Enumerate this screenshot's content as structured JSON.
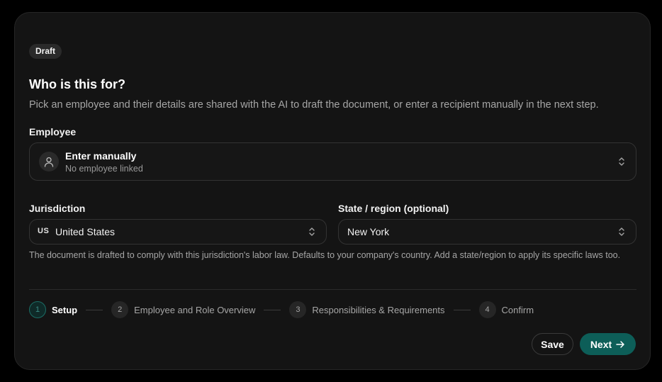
{
  "badge": "Draft",
  "title": "Who is this for?",
  "subtitle": "Pick an employee and their details are shared with the AI to draft the document, or enter a recipient manually in the next step.",
  "employee": {
    "label": "Employee",
    "value": "Enter manually",
    "subtext": "No employee linked"
  },
  "jurisdiction": {
    "label": "Jurisdiction",
    "flag": "US",
    "value": "United States"
  },
  "state": {
    "label": "State / region (optional)",
    "value": "New York"
  },
  "help_text": "The document is drafted to comply with this jurisdiction's labor law. Defaults to your company's country. Add a state/region to apply its specific laws too.",
  "steps": [
    {
      "num": "1",
      "label": "Setup"
    },
    {
      "num": "2",
      "label": "Employee and Role Overview"
    },
    {
      "num": "3",
      "label": "Responsibilities & Requirements"
    },
    {
      "num": "4",
      "label": "Confirm"
    }
  ],
  "actions": {
    "save": "Save",
    "next": "Next"
  },
  "colors": {
    "accent": "#0d5e58",
    "background": "#141414"
  }
}
